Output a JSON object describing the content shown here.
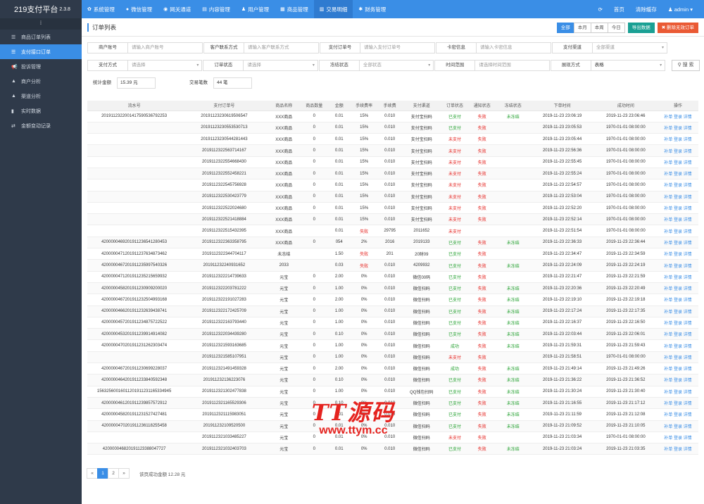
{
  "brand": {
    "name": "219支付平台",
    "version": "2.3.8"
  },
  "topnav": [
    {
      "label": "系统管理",
      "icon": "gear-icon",
      "glyph": "✿"
    },
    {
      "label": "微信管理",
      "icon": "wechat-icon",
      "glyph": "●"
    },
    {
      "label": "网关通道",
      "icon": "gateway-icon",
      "glyph": "◉"
    },
    {
      "label": "内容管理",
      "icon": "content-icon",
      "glyph": "▤"
    },
    {
      "label": "用户管理",
      "icon": "user-icon",
      "glyph": "♟"
    },
    {
      "label": "商品管理",
      "icon": "goods-icon",
      "glyph": "▦"
    },
    {
      "label": "交易明细",
      "icon": "chart-icon",
      "glyph": "▥",
      "active": true
    },
    {
      "label": "财务管理",
      "icon": "finance-icon",
      "glyph": "✱"
    }
  ],
  "topright": {
    "refresh_icon": "refresh-icon",
    "home": "首页",
    "clear_cache": "清除缓存",
    "user": "admin"
  },
  "sidebar": {
    "toggle": "⁞",
    "items": [
      {
        "label": "商品订单列表",
        "icon": "list-icon",
        "glyph": "☰"
      },
      {
        "label": "支付接口订单",
        "icon": "list-icon",
        "glyph": "☰",
        "active": true
      },
      {
        "label": "投诉管理",
        "icon": "megaphone-icon",
        "glyph": "📢"
      },
      {
        "label": "商户分析",
        "icon": "area-chart-icon",
        "glyph": "▲"
      },
      {
        "label": "渠道分析",
        "icon": "area-chart-icon",
        "glyph": "▲"
      },
      {
        "label": "实时数据",
        "icon": "bar-chart-icon",
        "glyph": "▮"
      },
      {
        "label": "金额变动记录",
        "icon": "exchange-icon",
        "glyph": "⇄"
      }
    ]
  },
  "panel": {
    "title": "订单列表"
  },
  "quick": {
    "all": "全部",
    "month": "本月",
    "week": "本周",
    "today": "今日",
    "export": "导出数据",
    "delete": "删除无效订单"
  },
  "filters": {
    "row1": [
      {
        "label": "商户账号",
        "placeholder": "请输入商户账号",
        "type": "input"
      },
      {
        "label": "客户联系方式",
        "placeholder": "请输入客户联系方式",
        "type": "input"
      },
      {
        "label": "支付订单号",
        "placeholder": "请输入支付订单号",
        "type": "input"
      },
      {
        "label": "卡密信息",
        "placeholder": "请输入卡密信息",
        "type": "input"
      },
      {
        "label": "支付渠道",
        "placeholder": "全部渠道",
        "type": "select"
      }
    ],
    "row2": [
      {
        "label": "支付方式",
        "placeholder": "请选择",
        "type": "select"
      },
      {
        "label": "订单状态",
        "placeholder": "请选择",
        "type": "select"
      },
      {
        "label": "冻结状态",
        "placeholder": "全部状态",
        "type": "select"
      },
      {
        "label": "时间范围",
        "placeholder": "请选择时间范围",
        "type": "input"
      },
      {
        "label": "展现方式",
        "placeholder": "表格",
        "type": "select",
        "value": true
      }
    ],
    "search": "搜 索"
  },
  "stats": {
    "amount_label": "统计金额",
    "amount_value": "15.39 元",
    "count_label": "交易笔数",
    "count_value": "44 笔"
  },
  "table": {
    "headers": [
      "流水号",
      "支付订单号",
      "商品名称",
      "商品数量",
      "金额",
      "手续费率",
      "手续费",
      "支付渠道",
      "订单状态",
      "通知状态",
      "冻结状态",
      "下单时间",
      "成功时间",
      "操作"
    ],
    "rows": [
      [
        "201911232200141759053679225​3",
        "20191123230619506547",
        "XXX商品",
        "0",
        "0.01",
        "15%",
        "0.010",
        "支付宝扫码",
        "已支付",
        "失败",
        "未冻结",
        "2019-11-23 23:06:19",
        "2019-11-23 23:06:46"
      ],
      [
        "",
        "20191123230553530713",
        "XXX商品",
        "0",
        "0.01",
        "15%",
        "0.010",
        "支付宝扫码",
        "已支付",
        "失败",
        "",
        "2019-11-23 23:05:53",
        "1970-01-01 08:00:00"
      ],
      [
        "",
        "20191123230544281443",
        "XXX商品",
        "0",
        "0.01",
        "15%",
        "0.010",
        "支付宝扫码",
        "未支付",
        "失败",
        "",
        "2019-11-23 23:05:44",
        "1970-01-01 08:00:00"
      ],
      [
        "",
        "20191123225637141​67",
        "XXX商品",
        "0",
        "0.01",
        "15%",
        "0.010",
        "支付宝扫码",
        "未支付",
        "失败",
        "",
        "2019-11-23 22:56:36",
        "1970-01-01 08:00:00"
      ],
      [
        "",
        "20191123225546684​30",
        "XXX商品",
        "0",
        "0.01",
        "15%",
        "0.010",
        "支付宝扫码",
        "未支付",
        "失败",
        "",
        "2019-11-23 22:55:45",
        "1970-01-01 08:00:00"
      ],
      [
        "",
        "20191123225524582​21",
        "XXX商品",
        "0",
        "0.01",
        "15%",
        "0.010",
        "支付宝扫码",
        "未支付",
        "失败",
        "",
        "2019-11-23 22:55:24",
        "1970-01-01 08:00:00"
      ],
      [
        "",
        "20191123225457569​28",
        "XXX商品",
        "0",
        "0.01",
        "15%",
        "0.010",
        "支付宝扫码",
        "未支付",
        "失败",
        "",
        "2019-11-23 22:54:57",
        "1970-01-01 08:00:00"
      ],
      [
        "",
        "20191123225304237​79",
        "XXX商品",
        "0",
        "0.01",
        "15%",
        "0.010",
        "支付宝扫码",
        "未支付",
        "失败",
        "",
        "2019-11-23 22:53:04",
        "1970-01-01 08:00:00"
      ],
      [
        "",
        "20191123225220246​80",
        "XXX商品",
        "0",
        "0.01",
        "15%",
        "0.010",
        "支付宝扫码",
        "未支付",
        "失败",
        "",
        "2019-11-23 22:52:20",
        "1970-01-01 08:00:00"
      ],
      [
        "",
        "20191123225214188​84",
        "XXX商品",
        "0",
        "0.01",
        "15%",
        "0.010",
        "支付宝扫码",
        "未支付",
        "失败",
        "",
        "2019-11-23 22:52:14",
        "1970-01-01 08:00:00"
      ],
      [
        "",
        "20191123225154323​95",
        "XXX商品",
        "",
        "0.01",
        "失败",
        "29795",
        "2011652",
        "未支付",
        "",
        "",
        "2019-11-23 22:51:54",
        "1970-01-01 08:00:00"
      ],
      [
        "420000046920191123654128045​3",
        "20191123223633587​95",
        "XXX商品",
        "0",
        "054",
        "2%",
        "2016",
        "2019133",
        "已支付",
        "失败",
        "未冻结",
        "2019-11-23 22:36:33",
        "2019-11-23 22:36:44"
      ],
      [
        "420000047120191123763487346​2",
        "20191123223447041​17",
        "未冻结",
        "",
        "1.50",
        "失败",
        "201",
        "20财09",
        "已支付",
        "失败",
        "",
        "2019-11-23 22:34:47",
        "2019-11-23 22:34:59"
      ],
      [
        "420000046720191123599754032​6",
        "20191123224093165​2",
        "2033",
        "",
        "0.03",
        "失败",
        "0.010",
        "4209932",
        "已支付",
        "失败",
        "未冻结",
        "2019-11-23 22:24:09",
        "2019-11-23 22:24:19"
      ],
      [
        "420000047120191123521565993​2",
        "20191123222147396​33",
        "元宝",
        "0",
        "2.00",
        "0%",
        "0.010",
        "微信00码",
        "已支付",
        "失败",
        "",
        "2019-11-23 22:21:47",
        "2019-11-23 22:21:59"
      ],
      [
        "420000045820191123090920002​0",
        "20191123222037812​22",
        "元宝",
        "0",
        "1.00",
        "0%",
        "0.010",
        "微信扫码",
        "已支付",
        "失败",
        "未冻结",
        "2019-11-23 22:20:36",
        "2019-11-23 22:20:49"
      ],
      [
        "420000046720191123250499316​8",
        "20191123221910272​83",
        "元宝",
        "0",
        "2.00",
        "0%",
        "0.010",
        "微信扫码",
        "已支付",
        "失败",
        "未冻结",
        "2019-11-23 22:19:10",
        "2019-11-23 22:19:18"
      ],
      [
        "420000046620191123263943874​1",
        "20191123221724257​09",
        "元宝",
        "0",
        "1.00",
        "0%",
        "0.010",
        "微信扫码",
        "已支付",
        "失败",
        "未冻结",
        "2019-11-23 22:17:24",
        "2019-11-23 22:17:35"
      ],
      [
        "420000045720191123487572252​2",
        "20191123221637934​40",
        "元宝",
        "0",
        "1.00",
        "0%",
        "0.010",
        "微信扫码",
        "已支付",
        "失败",
        "未冻结",
        "2019-11-23 22:16:37",
        "2019-11-23 22:16:50"
      ],
      [
        "420000045320191123991491408​2",
        "20191123220344392​80",
        "元宝",
        "0",
        "0.10",
        "0%",
        "0.010",
        "微信扫码",
        "已支付",
        "失败",
        "未冻结",
        "2019-11-23 22:03:44",
        "2019-11-23 22:06:01"
      ],
      [
        "420000047020191123126230347​4",
        "20191123215931636​85",
        "元宝",
        "0",
        "1.00",
        "0%",
        "0.010",
        "微信扫码",
        "成功",
        "失败",
        "未冻结",
        "2019-11-23 21:59:31",
        "2019-11-23 21:59:43"
      ],
      [
        "",
        "20191123215851079​51",
        "元宝",
        "0",
        "1.00",
        "0%",
        "0.010",
        "微信扫码",
        "未支付",
        "失败",
        "",
        "2019-11-23 21:58:51",
        "1970-01-01 08:00:00"
      ],
      [
        "420000046720191123069922803​7",
        "20191123214914593​28",
        "元宝",
        "0",
        "2.00",
        "0%",
        "0.010",
        "微信扫码",
        "成功",
        "失败",
        "未冻结",
        "2019-11-23 21:49:14",
        "2019-11-23 21:49:26"
      ],
      [
        "420000046420191123384059234​8",
        "20191123213622307​6",
        "元宝",
        "0",
        "0.10",
        "0%",
        "0.010",
        "微信扫码",
        "已支付",
        "失败",
        "未冻结",
        "2019-11-23 21:36:22",
        "2019-11-23 21:36:52"
      ],
      [
        "156325600160112019112311653​34945",
        "20191123213024778​38",
        "元宝",
        "0",
        "1.00",
        "0%",
        "0.010",
        "QQ钱包扫码",
        "已支付",
        "失败",
        "未冻结",
        "2019-11-23 21:30:24",
        "2019-11-23 21:30:40"
      ],
      [
        "420000046120191123985757291​2",
        "20191123211655293​06",
        "元宝",
        "0",
        "0.10",
        "0%",
        "0.010",
        "微信扫码",
        "已支付",
        "失败",
        "未冻结",
        "2019-11-23 21:16:55",
        "2019-11-23 21:17:12"
      ],
      [
        "420000045820191123152742748​1",
        "20191123211159830​51",
        "元宝",
        "0",
        "0.01",
        "0%",
        "0.010",
        "微信扫码",
        "已支付",
        "失败",
        "未冻结",
        "2019-11-23 21:11:59",
        "2019-11-23 21:12:08"
      ],
      [
        "420000047020191123611825545​8",
        "20191123210952050​0",
        "元宝",
        "0",
        "0.01",
        "0%",
        "0.010",
        "微信扫码",
        "已支付",
        "失败",
        "未冻结",
        "2019-11-23 21:09:52",
        "2019-11-23 21:10:05"
      ],
      [
        "",
        "20191123210334852​27",
        "元宝",
        "0",
        "0.01",
        "0%",
        "0.010",
        "微信扫码",
        "未支付",
        "失败",
        "",
        "2019-11-23 21:03:34",
        "1970-01-01 08:00:00"
      ],
      [
        "420000046820191123388047727",
        "20191123210324037​03",
        "元宝",
        "0",
        "0.01",
        "0%",
        "0.010",
        "微信扫码",
        "已支付",
        "失败",
        "未冻结",
        "2019-11-23 21:03:24",
        "2019-11-23 21:03:35"
      ]
    ],
    "ops": [
      "补单",
      "登录",
      "详情"
    ]
  },
  "pager": {
    "prev": "«",
    "pages": [
      "1",
      "2"
    ],
    "next": "»",
    "info": "该页成功金额 12.28 元"
  },
  "watermark": {
    "big": "TT源码",
    "small": "www.ttym.cc"
  }
}
